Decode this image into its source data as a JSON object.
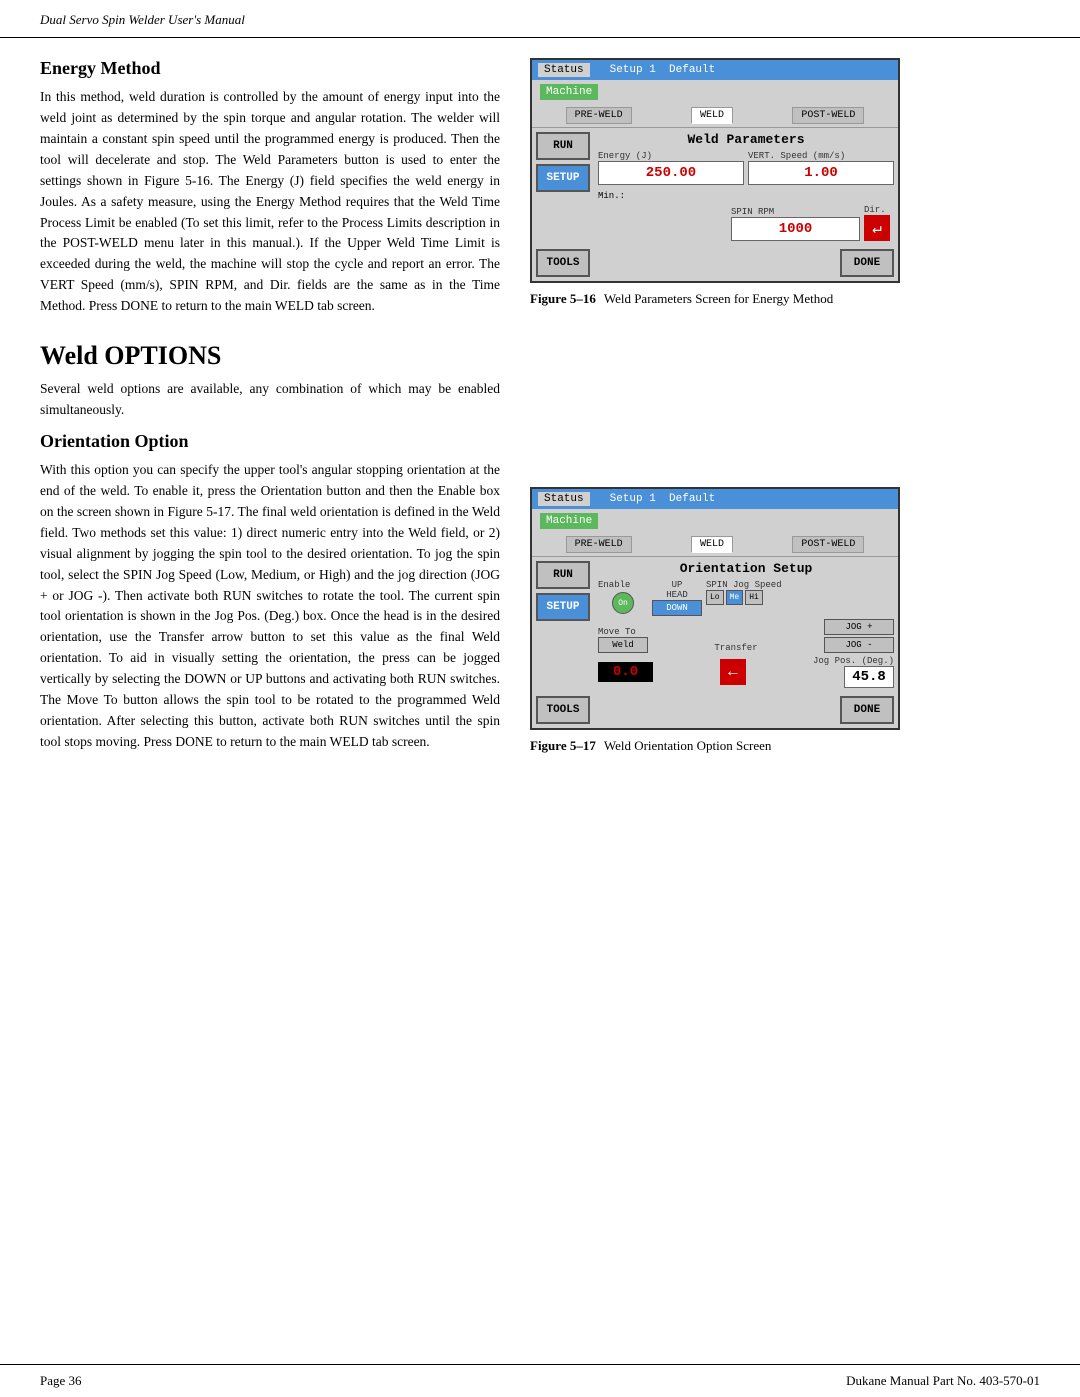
{
  "header": {
    "text": "Dual Servo Spin Welder User's Manual"
  },
  "footer": {
    "page": "Page   36",
    "manual": "Dukane Manual Part No. 403-570-01"
  },
  "energy_method": {
    "heading": "Energy Method",
    "body1": "In this method, weld duration is controlled by the amount of energy input into the weld joint as determined by the spin torque and angular rotation. The welder will maintain a constant spin speed until the programmed energy is produced. Then the tool will decelerate and stop. The Weld Parameters button is used to enter the settings shown in Figure 5-16. The Energy (J) field specifies the weld energy in Joules. As a safety measure, using the Energy Method requires that the Weld Time Process Limit be enabled (To set this limit, refer to the Process Limits description in the POST-WELD menu later in this manual.). If the Upper Weld Time Limit is exceeded during the weld, the machine will stop the cycle and report an error. The VERT Speed (mm/s), SPIN RPM, and Dir. fields are the same as in the Time Method. Press DONE to return to the main WELD tab screen."
  },
  "figure16": {
    "label": "Figure 5–16",
    "caption": "Weld Parameters Screen for Energy Method"
  },
  "screen1": {
    "status_label": "Status",
    "setup_label": "Setup 1",
    "default_label": "Default",
    "machine_label": "Machine",
    "tab_pre_weld": "PRE-WELD",
    "tab_weld": "WELD",
    "tab_post_weld": "POST-WELD",
    "section_title": "Weld Parameters",
    "energy_label": "Energy (J)",
    "vert_speed_label": "VERT. Speed (mm/s)",
    "energy_value": "250.00",
    "vert_speed_value": "1.00",
    "min_label": "Min.:",
    "spin_rpm_label": "SPIN RPM",
    "dir_label": "Dir.",
    "spin_rpm_value": "1000",
    "btn_run": "RUN",
    "btn_setup": "SETUP",
    "btn_tools": "TOOLS",
    "btn_done": "DONE"
  },
  "weld_options": {
    "heading": "Weld OPTIONS",
    "body1": "Several weld options are available, any combination of which may be enabled simultaneously."
  },
  "orientation_option": {
    "heading": "Orientation Option",
    "body1": "With this option you can specify the upper tool's angular stopping orientation at the end of the weld. To enable it, press the Orientation button and then the Enable box on the screen shown in Figure 5-17. The final weld orientation is defined in the Weld field. Two methods set this value: 1) direct numeric entry into the Weld field, or 2) visual alignment by jogging the spin tool to the desired orientation. To jog the spin tool, select the SPIN Jog Speed (Low, Medium, or High) and the jog direction (JOG + or JOG -). Then activate both RUN switches to rotate the tool. The current spin tool orientation is shown in the Jog Pos. (Deg.) box. Once the head is in the desired orientation, use the Transfer arrow button to set this value as the final Weld orientation. To aid in visually setting the orientation, the press can be jogged vertically by selecting the DOWN or UP buttons and activating both RUN switches. The Move To button allows the spin tool to be rotated to the programmed Weld orientation. After selecting this button, activate both RUN switches until the spin tool stops moving. Press DONE to return to the main WELD tab screen."
  },
  "figure17": {
    "label": "Figure 5–17",
    "caption": "Weld Orientation Option Screen"
  },
  "screen2": {
    "status_label": "Status",
    "setup_label": "Setup 1",
    "default_label": "Default",
    "machine_label": "Machine",
    "tab_pre_weld": "PRE-WELD",
    "tab_weld": "WELD",
    "tab_post_weld": "POST-WELD",
    "section_title": "Orientation Setup",
    "enable_label": "Enable",
    "on_label": "On",
    "up_label": "UP",
    "head_label": "HEAD",
    "down_label": "DOWN",
    "spin_jog_label": "SPIN Jog Speed",
    "lo_label": "Lo",
    "me_label": "Me",
    "hi_label": "Hi",
    "move_to_label": "Move To",
    "weld_label": "Weld",
    "transfer_label": "Transfer",
    "jog_plus_label": "JOG +",
    "jog_minus_label": "JOG -",
    "jog_pos_label": "Jog Pos. (Deg.)",
    "weld_value": "0.0",
    "jog_pos_value": "45.8",
    "btn_run": "RUN",
    "btn_setup": "SETUP",
    "btn_tools": "TOOLS",
    "btn_done": "DONE"
  }
}
